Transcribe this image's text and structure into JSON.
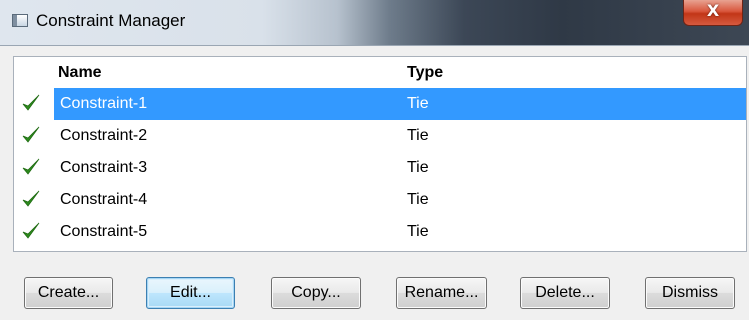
{
  "window": {
    "title": "Constraint Manager",
    "close_symbol": "X",
    "app_icon": "window-icon",
    "close_icon": "close-icon"
  },
  "table": {
    "columns": [
      "Name",
      "Type"
    ],
    "rows": [
      {
        "name": "Constraint-1",
        "type": "Tie",
        "active": true,
        "selected": true
      },
      {
        "name": "Constraint-2",
        "type": "Tie",
        "active": true,
        "selected": false
      },
      {
        "name": "Constraint-3",
        "type": "Tie",
        "active": true,
        "selected": false
      },
      {
        "name": "Constraint-4",
        "type": "Tie",
        "active": true,
        "selected": false
      },
      {
        "name": "Constraint-5",
        "type": "Tie",
        "active": true,
        "selected": false
      }
    ],
    "check_icon": "checkmark-icon",
    "check_color": "#2e8b1e",
    "selection_color": "#3399ff"
  },
  "buttons": {
    "create": "Create...",
    "edit": "Edit...",
    "copy": "Copy...",
    "rename": "Rename...",
    "delete": "Delete...",
    "dismiss": "Dismiss"
  }
}
